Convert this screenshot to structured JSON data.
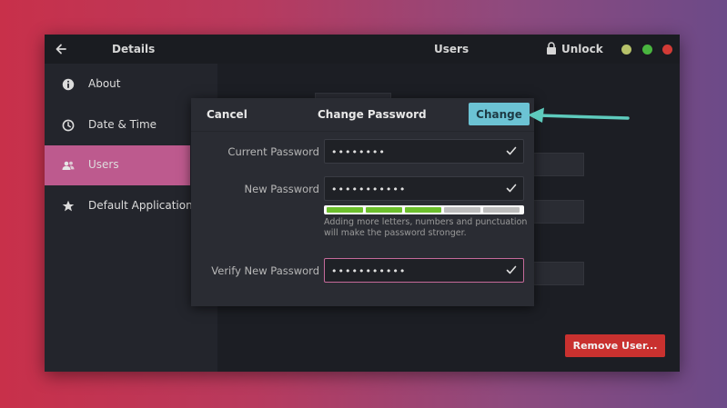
{
  "header": {
    "left_title": "Details",
    "center_title": "Users",
    "unlock_label": "Unlock",
    "window_controls": [
      "#b7c26a",
      "#49b53f",
      "#d23b36"
    ]
  },
  "sidebar": {
    "items": [
      {
        "label": "About",
        "icon": "info-icon",
        "active": false
      },
      {
        "label": "Date & Time",
        "icon": "clock-icon",
        "active": false
      },
      {
        "label": "Users",
        "icon": "users-icon",
        "active": true
      },
      {
        "label": "Default Applications",
        "icon": "star-icon",
        "active": false
      }
    ]
  },
  "main": {
    "remove_user_label": "Remove User..."
  },
  "dialog": {
    "cancel_label": "Cancel",
    "title": "Change Password",
    "change_label": "Change",
    "current_password": {
      "label": "Current Password",
      "value": "••••••••"
    },
    "new_password": {
      "label": "New Password",
      "value": "•••••••••••"
    },
    "verify_password": {
      "label": "Verify New Password",
      "value": "•••••••••••"
    },
    "strength": {
      "filled_segments": 3,
      "total_segments": 5,
      "filled_color": "#6cbf2d",
      "empty_color": "#bdbdbd"
    },
    "hint": "Adding more letters, numbers and punctuation will make the password stronger."
  },
  "annotation": {
    "arrow_color": "#5ecbbd"
  },
  "colors": {
    "accent_pink": "#bd5a8e",
    "change_button": "#6cc3d4",
    "danger": "#c9312f"
  }
}
